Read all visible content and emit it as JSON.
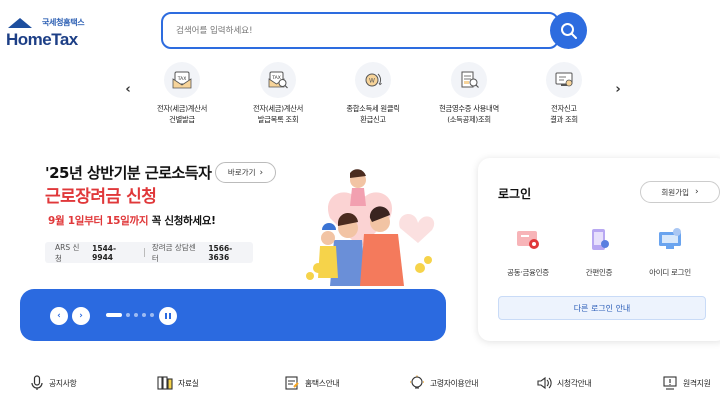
{
  "header": {
    "logo_kr": "국세청홈택스",
    "logo_en": "HomeTax",
    "search_placeholder": "검색어를 입력하세요!"
  },
  "quick_menu": [
    {
      "icon": "tax-invoice-icon",
      "label": "전자(세금)계산서\n건별발급"
    },
    {
      "icon": "invoice-search-icon",
      "label": "전자(세금)계산서\n발급목록 조회"
    },
    {
      "icon": "refund-icon",
      "label": "종합소득세 원클릭\n환급신고"
    },
    {
      "icon": "receipt-icon",
      "label": "현금영수증 사용내역\n(소득공제)조회"
    },
    {
      "icon": "report-result-icon",
      "label": "전자신고\n결과 조회"
    }
  ],
  "banner": {
    "title": "'25년 상반기분 근로소득자",
    "button": "바로가기",
    "subtitle": "근로장려금 신청",
    "date_red": "9월 1일부터 15일까지",
    "date_rest": " 꼭 신청하세요!",
    "ars_label": "ARS 신청",
    "ars_number": "1544-9944",
    "center_label": "장려금 상담센터",
    "center_number": "1566-3636"
  },
  "login": {
    "title": "로그인",
    "join": "회원가입",
    "options": [
      {
        "icon": "certificate-icon",
        "label": "공동·금융인증"
      },
      {
        "icon": "simple-auth-icon",
        "label": "간편인증"
      },
      {
        "icon": "id-login-icon",
        "label": "아이디 로그인"
      }
    ],
    "other": "다른 로그인 안내"
  },
  "bottom_nav": [
    {
      "icon": "microphone-icon",
      "label": "공지사항"
    },
    {
      "icon": "archive-icon",
      "label": "자료실"
    },
    {
      "icon": "document-icon",
      "label": "홈택스안내"
    },
    {
      "icon": "lightbulb-icon",
      "label": "고령자이용안내"
    },
    {
      "icon": "speaker-icon",
      "label": "시청각안내"
    },
    {
      "icon": "remote-support-icon",
      "label": "원격지원"
    }
  ],
  "colors": {
    "primary": "#2d6cdf",
    "accent_red": "#e0383a",
    "logo_navy": "#1d3f86"
  }
}
